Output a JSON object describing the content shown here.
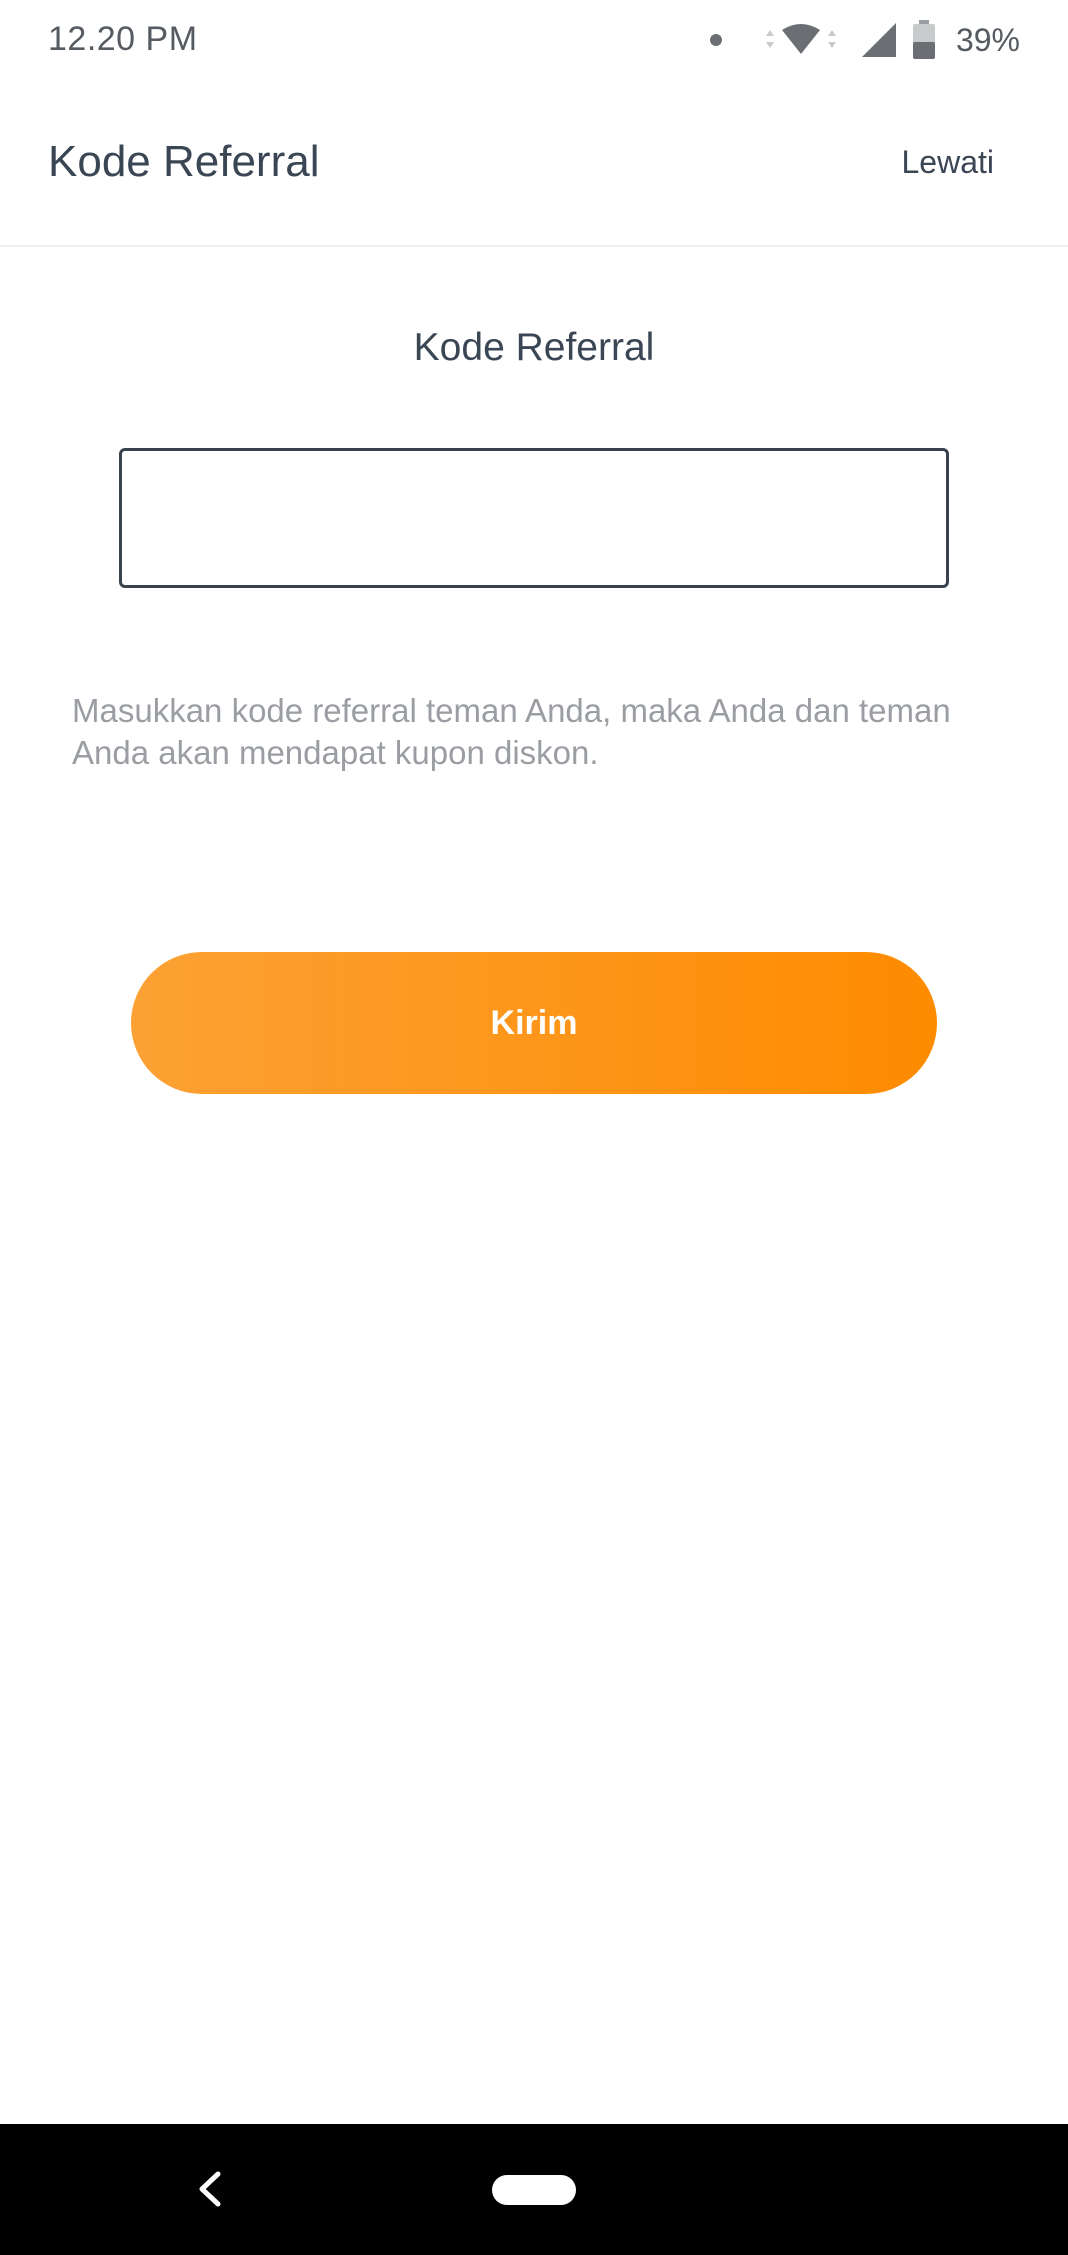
{
  "status_bar": {
    "time": "12.20 PM",
    "battery_percent": "39%",
    "icons": [
      "notification-dot-icon",
      "wifi-icon",
      "cell-signal-icon",
      "battery-icon"
    ]
  },
  "app_bar": {
    "title": "Kode Referral",
    "skip_label": "Lewati"
  },
  "content": {
    "section_title": "Kode Referral",
    "input_value": "",
    "helper_text": "Masukkan kode referral teman Anda, maka Anda dan teman Anda akan mendapat kupon diskon.",
    "submit_label": "Kirim"
  },
  "nav_bar": {
    "icons": [
      "back-icon",
      "home-pill-icon"
    ]
  },
  "colors": {
    "accent_start": "#fca134",
    "accent_end": "#fe8b00",
    "text_primary": "#3a4654",
    "text_secondary": "#9a9ea3"
  }
}
